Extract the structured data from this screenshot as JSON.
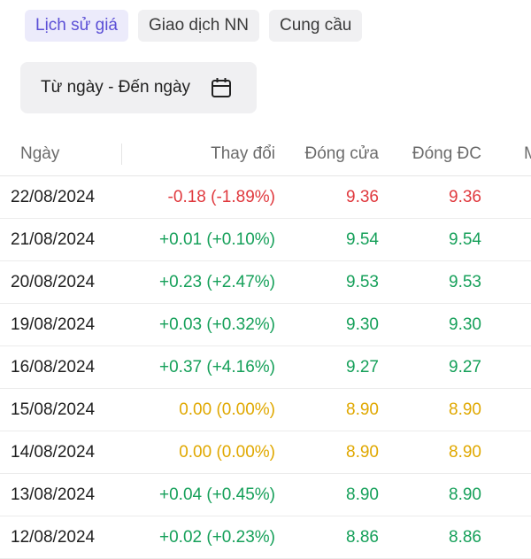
{
  "tabs": [
    {
      "label": "Lịch sử giá",
      "active": true
    },
    {
      "label": "Giao dịch NN",
      "active": false
    },
    {
      "label": "Cung cầu",
      "active": false
    }
  ],
  "date_range": {
    "label": "Từ ngày - Đến ngày",
    "icon": "calendar-icon"
  },
  "table": {
    "headers": {
      "date": "Ngày",
      "change": "Thay đổi",
      "close": "Đóng cửa",
      "adj_close": "Đóng ĐC",
      "next": "M"
    },
    "rows": [
      {
        "date": "22/08/2024",
        "change": "-0.18 (-1.89%)",
        "close": "9.36",
        "adj_close": "9.36",
        "trend": "red"
      },
      {
        "date": "21/08/2024",
        "change": "+0.01 (+0.10%)",
        "close": "9.54",
        "adj_close": "9.54",
        "trend": "green"
      },
      {
        "date": "20/08/2024",
        "change": "+0.23 (+2.47%)",
        "close": "9.53",
        "adj_close": "9.53",
        "trend": "green"
      },
      {
        "date": "19/08/2024",
        "change": "+0.03 (+0.32%)",
        "close": "9.30",
        "adj_close": "9.30",
        "trend": "green"
      },
      {
        "date": "16/08/2024",
        "change": "+0.37 (+4.16%)",
        "close": "9.27",
        "adj_close": "9.27",
        "trend": "green"
      },
      {
        "date": "15/08/2024",
        "change": "0.00 (0.00%)",
        "close": "8.90",
        "adj_close": "8.90",
        "trend": "yellow"
      },
      {
        "date": "14/08/2024",
        "change": "0.00 (0.00%)",
        "close": "8.90",
        "adj_close": "8.90",
        "trend": "yellow"
      },
      {
        "date": "13/08/2024",
        "change": "+0.04 (+0.45%)",
        "close": "8.90",
        "adj_close": "8.90",
        "trend": "green"
      },
      {
        "date": "12/08/2024",
        "change": "+0.02 (+0.23%)",
        "close": "8.86",
        "adj_close": "8.86",
        "trend": "green"
      }
    ]
  },
  "colors": {
    "accent": "#5b4fd6",
    "up": "#16a05a",
    "down": "#e0393e",
    "unchanged": "#e0a800"
  }
}
